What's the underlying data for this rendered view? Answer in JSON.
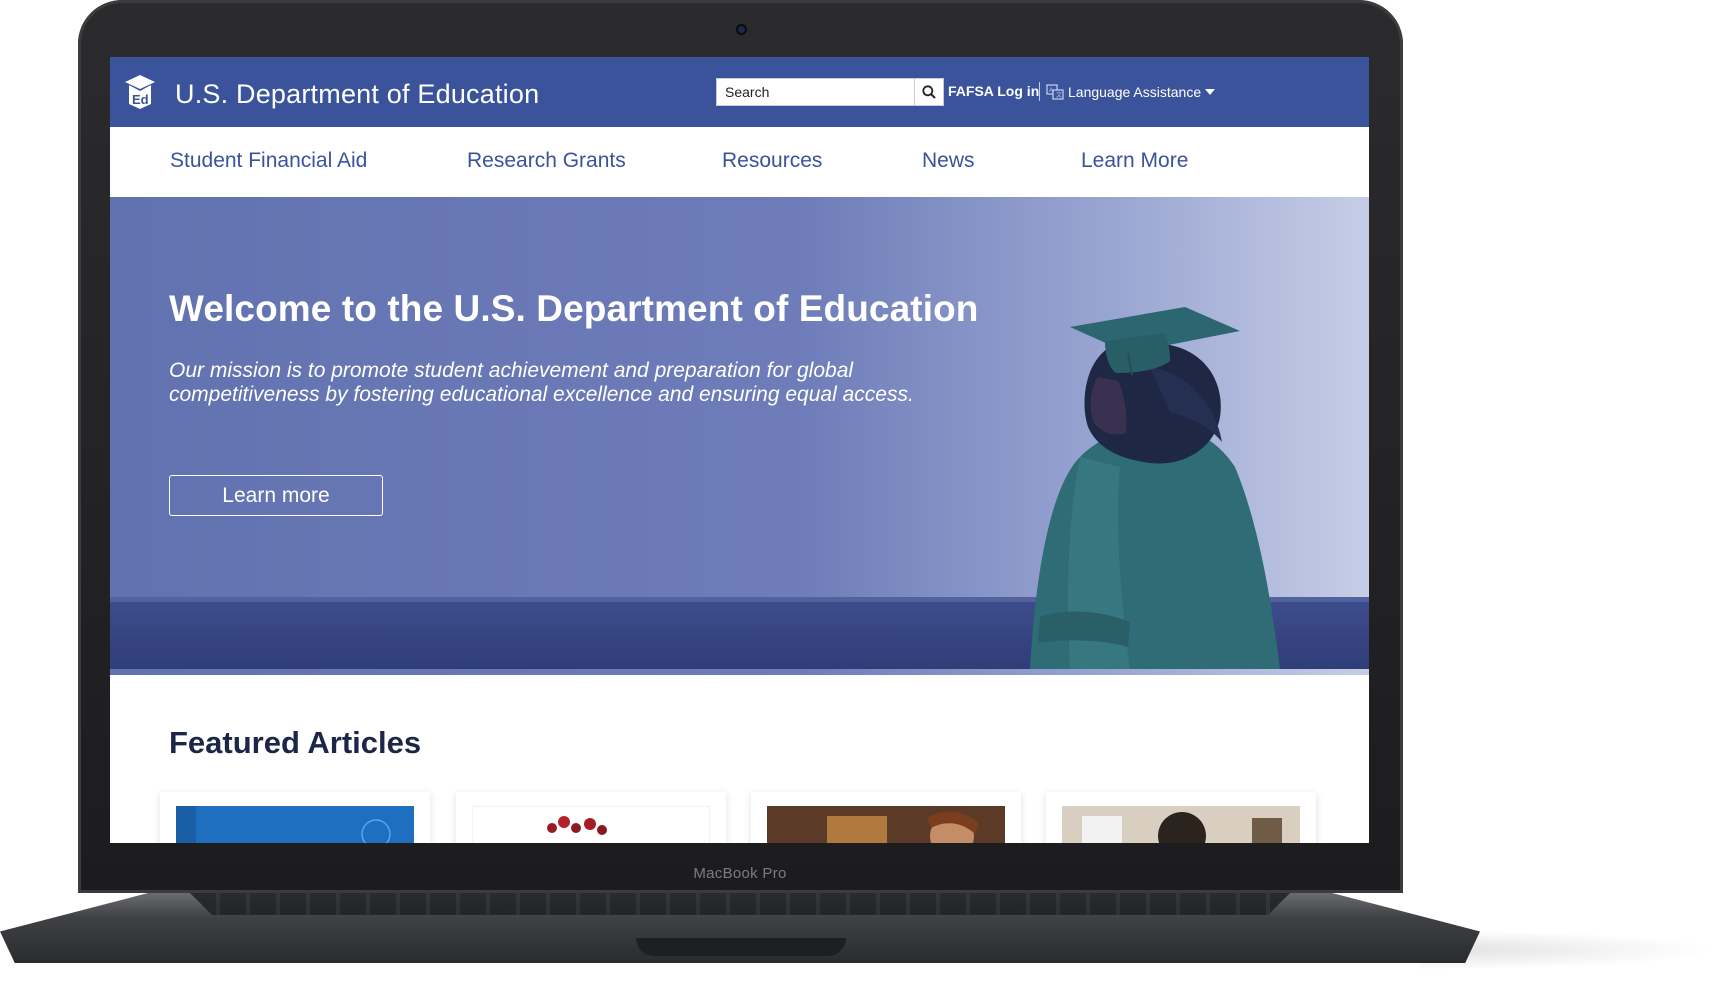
{
  "device": {
    "label": "MacBook Pro"
  },
  "header": {
    "site_title": "U.S. Department of Education",
    "search_placeholder": "Search",
    "fafsa_login": "FAFSA Log in",
    "language_assistance": "Language Assistance",
    "brand_color": "#3a539b"
  },
  "nav": {
    "items": [
      {
        "label": "Student Financial Aid"
      },
      {
        "label": "Research Grants"
      },
      {
        "label": "Resources"
      },
      {
        "label": "News"
      },
      {
        "label": "Learn More"
      }
    ]
  },
  "hero": {
    "title": "Welcome to the U.S. Department of Education",
    "subtitle": "Our mission is to promote student achievement and preparation for global competitiveness by fostering educational excellence and ensuring equal access.",
    "button_label": "Learn more"
  },
  "featured": {
    "title": "Featured Articles"
  },
  "icons": {
    "logo": "ed-logo-icon",
    "search": "search-icon",
    "language": "translate-icon",
    "caret": "caret-down-icon"
  }
}
